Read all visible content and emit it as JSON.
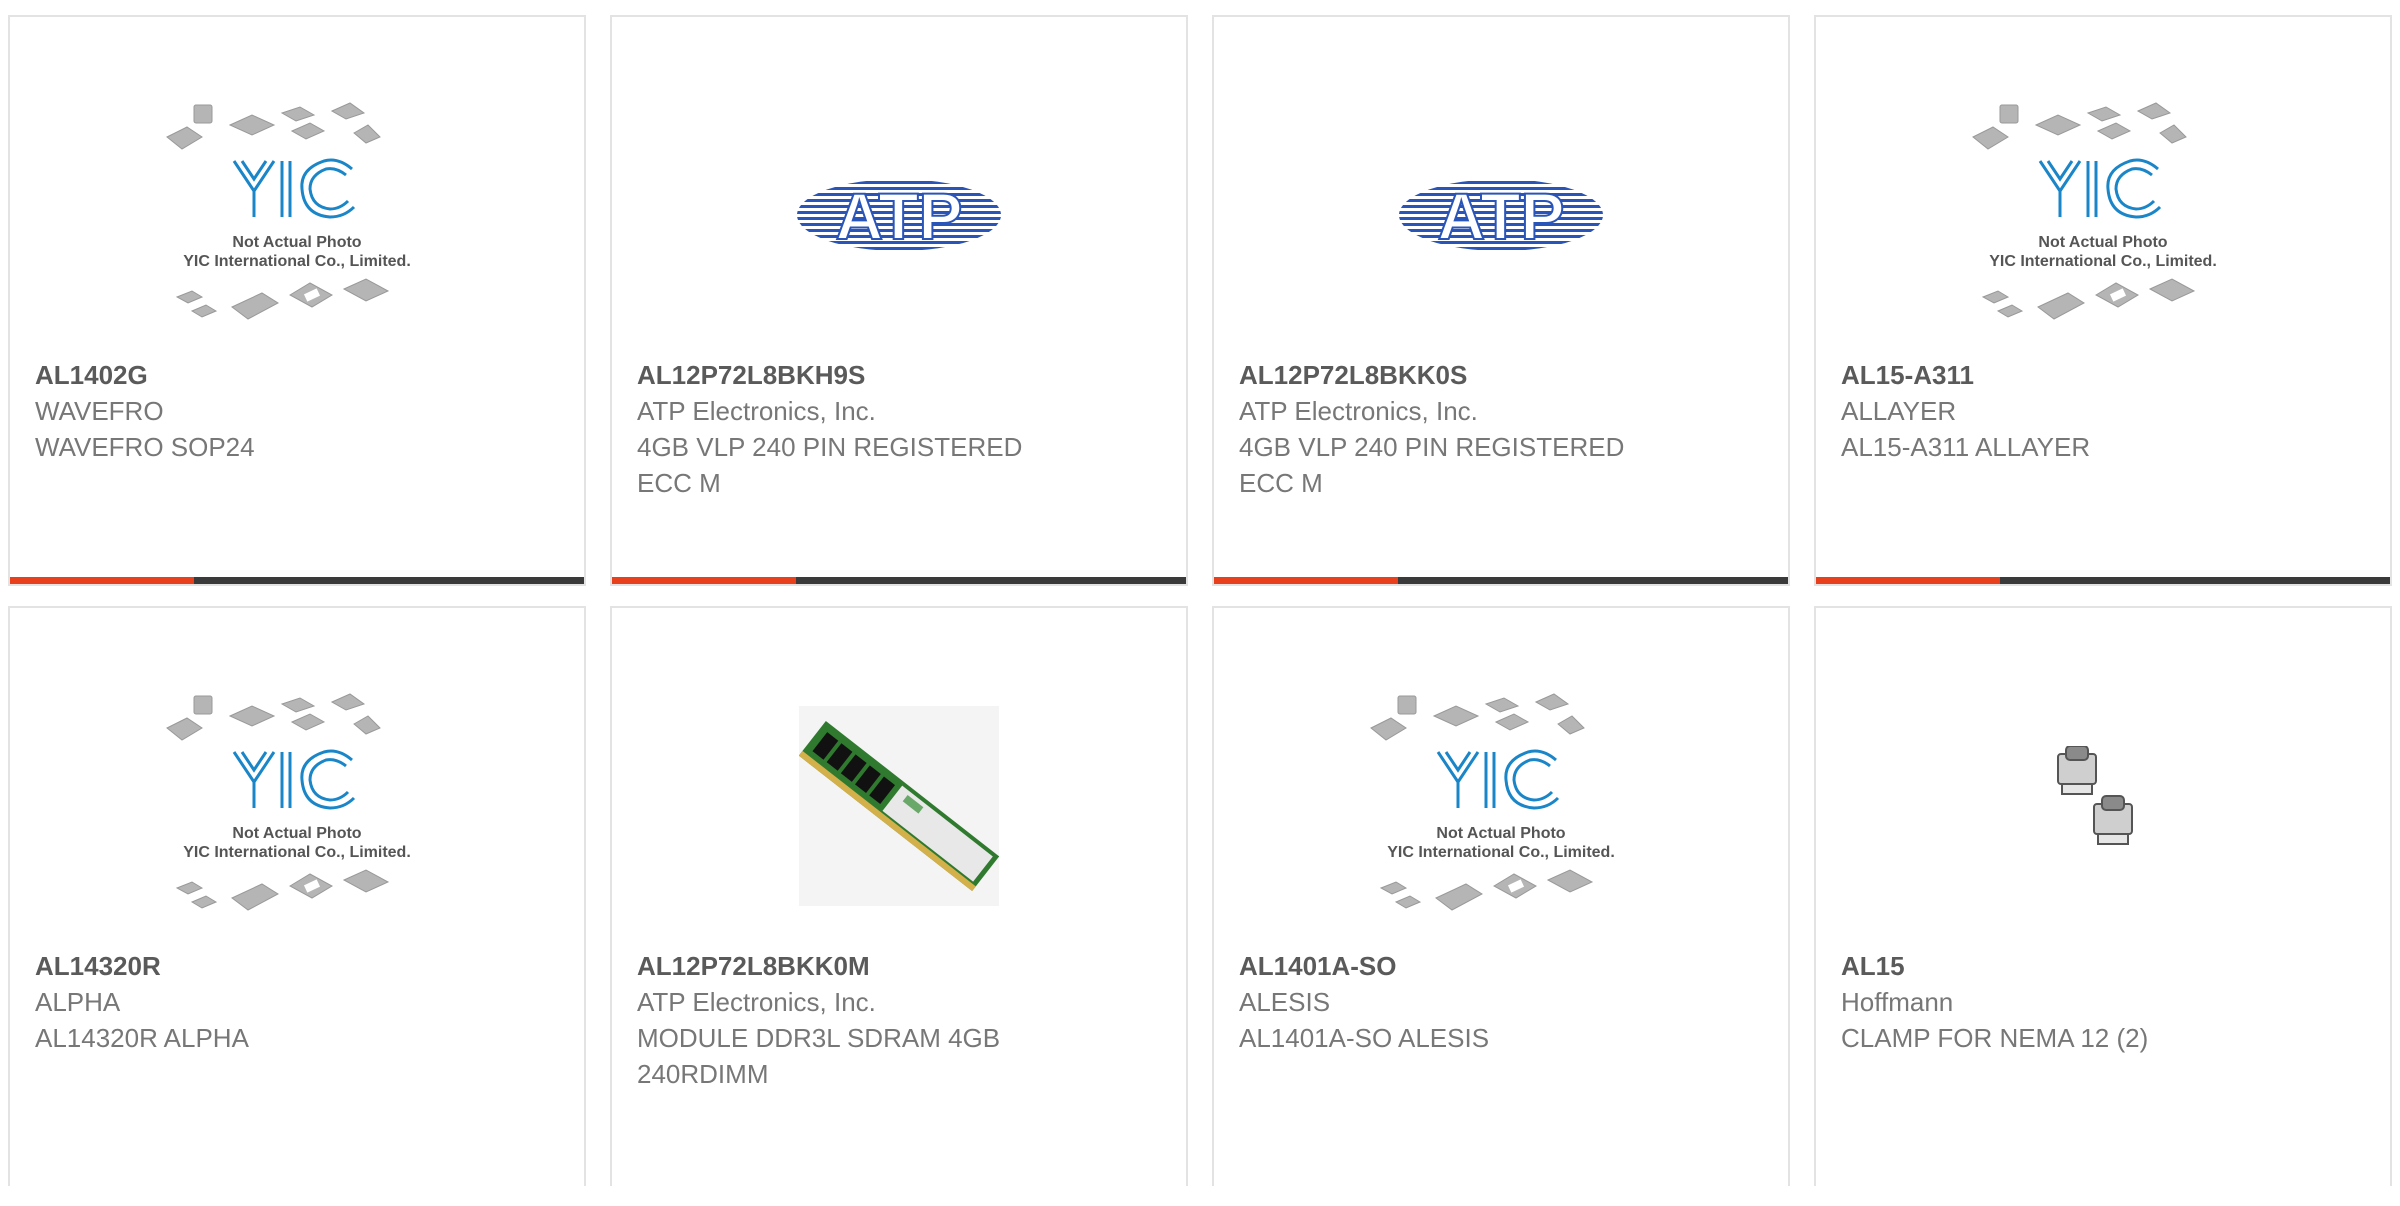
{
  "colors": {
    "accent_bar": "#e8401c",
    "dark_bar": "#3a3a3a",
    "card_border": "#e3e3e3",
    "yic_logo": "#1a86c8",
    "atp_logo": "#2a55b8"
  },
  "products": [
    {
      "part_number": "AL1402G",
      "manufacturer": "WAVEFRO",
      "description": "WAVEFRO SOP24",
      "image": "yic-placeholder",
      "image_text": {
        "logo": "YIC",
        "line1": "Not Actual Photo",
        "line2": "YIC International Co., Limited."
      }
    },
    {
      "part_number": "AL12P72L8BKH9S",
      "manufacturer": "ATP Electronics, Inc.",
      "description": "4GB VLP 240 PIN REGISTERED ECC M",
      "image": "atp-logo",
      "image_text": {
        "logo": "ATP"
      }
    },
    {
      "part_number": "AL12P72L8BKK0S",
      "manufacturer": "ATP Electronics, Inc.",
      "description": "4GB VLP 240 PIN REGISTERED ECC M",
      "image": "atp-logo",
      "image_text": {
        "logo": "ATP"
      }
    },
    {
      "part_number": "AL15-A311",
      "manufacturer": "ALLAYER",
      "description": "AL15-A311 ALLAYER",
      "image": "yic-placeholder",
      "image_text": {
        "logo": "YIC",
        "line1": "Not Actual Photo",
        "line2": "YIC International Co., Limited."
      }
    },
    {
      "part_number": "AL14320R",
      "manufacturer": "ALPHA",
      "description": "AL14320R ALPHA",
      "image": "yic-placeholder",
      "image_text": {
        "logo": "YIC",
        "line1": "Not Actual Photo",
        "line2": "YIC International Co., Limited."
      }
    },
    {
      "part_number": "AL12P72L8BKK0M",
      "manufacturer": "ATP Electronics, Inc.",
      "description": "MODULE DDR3L SDRAM 4GB 240RDIMM",
      "image": "ram-module"
    },
    {
      "part_number": "AL1401A-SO",
      "manufacturer": "ALESIS",
      "description": "AL1401A-SO ALESIS",
      "image": "yic-placeholder",
      "image_text": {
        "logo": "YIC",
        "line1": "Not Actual Photo",
        "line2": "YIC International Co., Limited."
      }
    },
    {
      "part_number": "AL15",
      "manufacturer": "Hoffmann",
      "description": "CLAMP FOR NEMA 12 (2)",
      "image": "clamp"
    }
  ]
}
